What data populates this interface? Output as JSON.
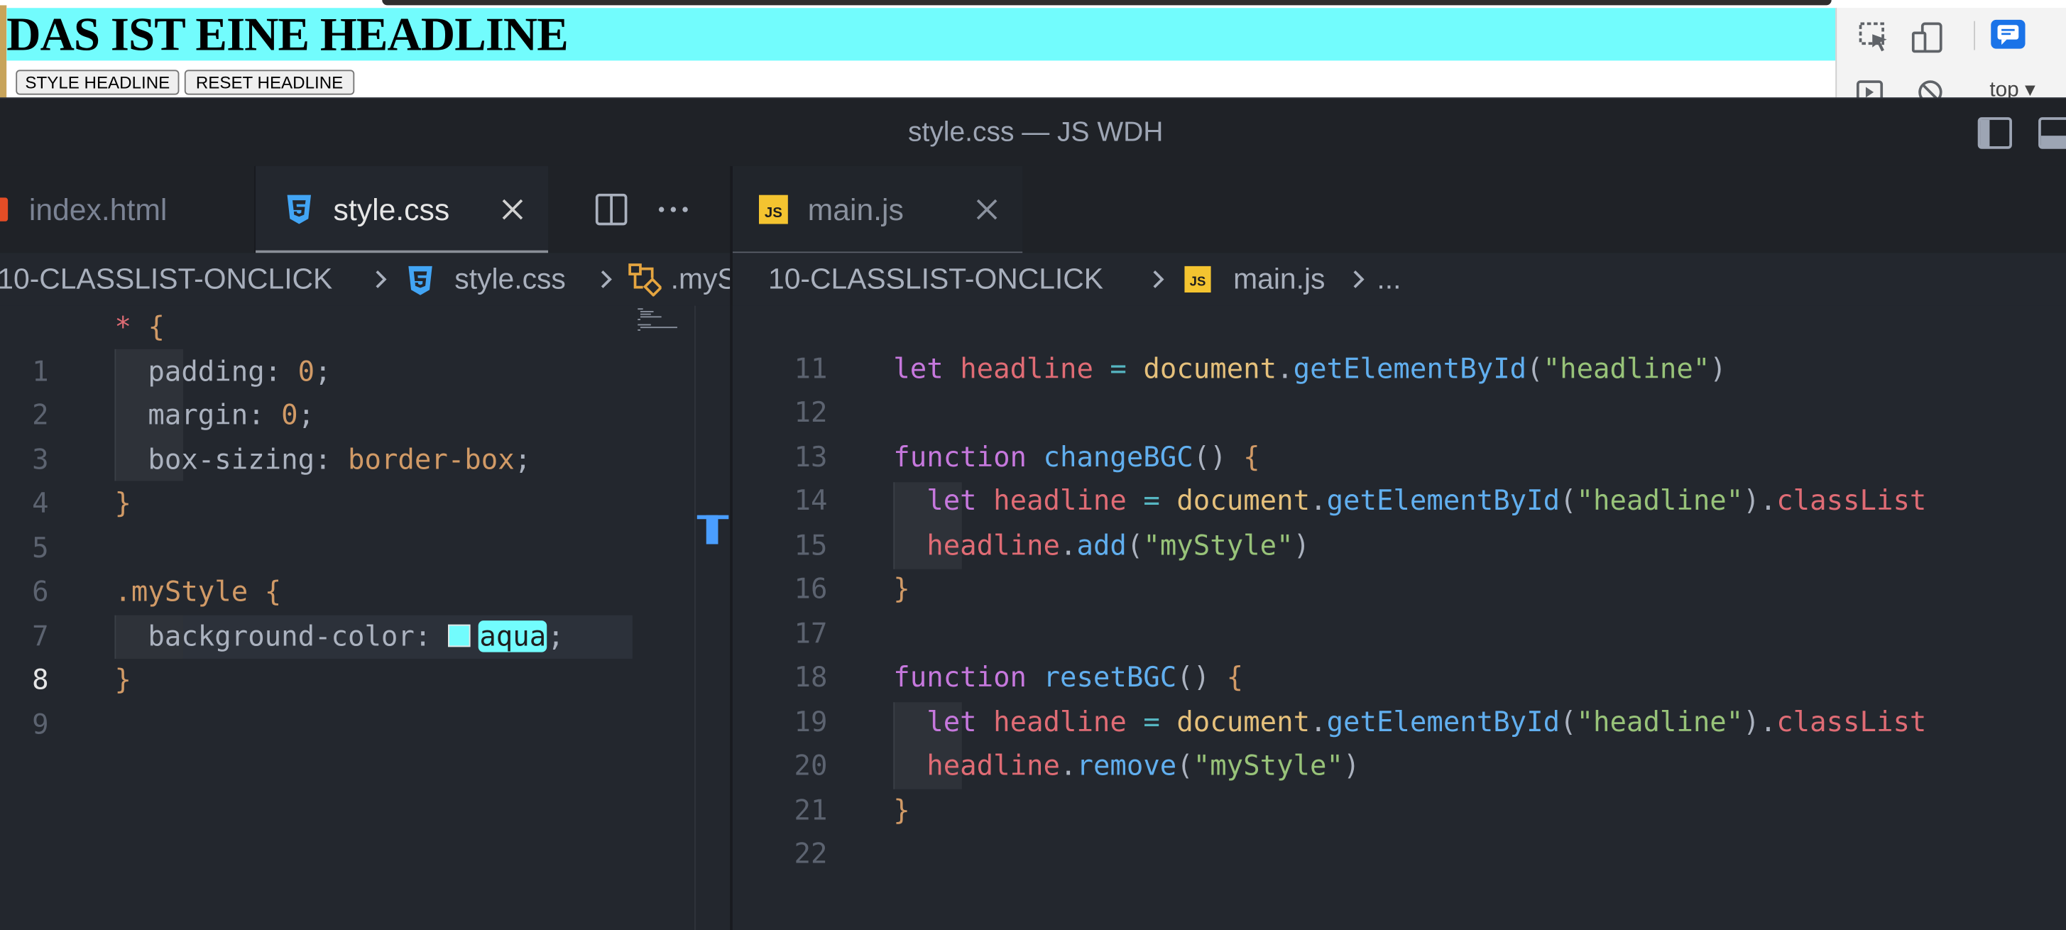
{
  "browser": {
    "headline": "DAS IST EINE HEADLINE",
    "buttons": {
      "style_label": "STYLE HEADLINE",
      "reset_label": "RESET HEADLINE"
    },
    "devtools": {
      "context": "top ▾"
    }
  },
  "window": {
    "title": "style.css — JS WDH"
  },
  "editor_left": {
    "tabs": [
      {
        "label": "index.html",
        "icon": "html-file-icon",
        "active": false
      },
      {
        "label": "style.css",
        "icon": "css-file-icon",
        "active": true
      }
    ],
    "breadcrumb": [
      "10-CLASSLIST-ONCLICK",
      "style.css",
      ".myStyle"
    ],
    "lines": [
      {
        "n": "1"
      },
      {
        "n": "2"
      },
      {
        "n": "3"
      },
      {
        "n": "4"
      },
      {
        "n": "5"
      },
      {
        "n": "6"
      },
      {
        "n": "7"
      },
      {
        "n": "8"
      },
      {
        "n": "9"
      }
    ],
    "code": {
      "l1_sel": "*",
      "l1_brace": "{",
      "l2_prop": "padding",
      "l2_val": "0",
      "l3_prop": "margin",
      "l3_val": "0",
      "l4_prop": "box-sizing",
      "l4_val": "border-box",
      "l5_brace": "}",
      "l7_class": ".myStyle",
      "l7_brace": "{",
      "l8_prop": "background-color",
      "l8_val": "aqua",
      "l9_brace": "}"
    },
    "colors": {
      "aqua_swatch": "#72fcfd"
    }
  },
  "editor_right": {
    "tabs": [
      {
        "label": "main.js",
        "icon": "js-file-icon",
        "active": false
      }
    ],
    "breadcrumb": [
      "10-CLASSLIST-ONCLICK",
      "main.js",
      "..."
    ],
    "lines": [
      {
        "n": "11"
      },
      {
        "n": "12"
      },
      {
        "n": "13"
      },
      {
        "n": "14"
      },
      {
        "n": "15"
      },
      {
        "n": "16"
      },
      {
        "n": "17"
      },
      {
        "n": "18"
      },
      {
        "n": "19"
      },
      {
        "n": "20"
      },
      {
        "n": "21"
      },
      {
        "n": "22"
      }
    ],
    "code": {
      "let": "let",
      "headline": "headline",
      "eq": "=",
      "document": "document",
      "getElementById": "getElementById",
      "str_headline": "\"headline\"",
      "classList": "classList",
      "function": "function",
      "changeBGC": "changeBGC",
      "resetBGC": "resetBGC",
      "add": "add",
      "remove": "remove",
      "str_myStyle": "\"myStyle\""
    }
  }
}
